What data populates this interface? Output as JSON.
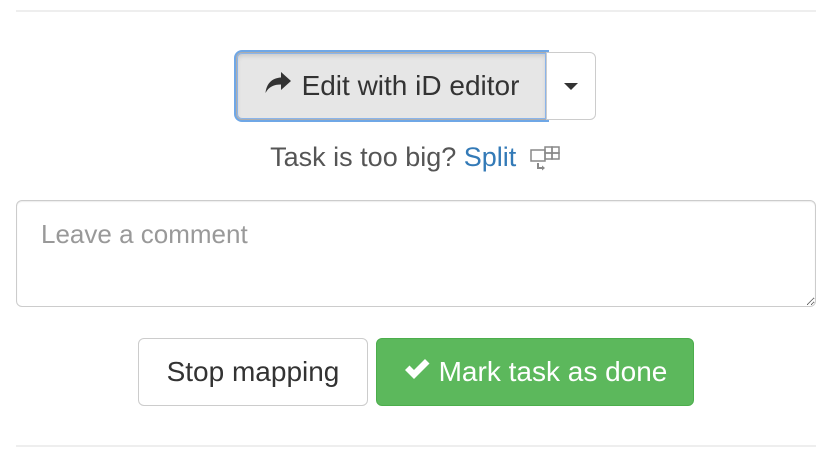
{
  "editor": {
    "edit_label": "Edit with iD editor",
    "edit_icon": "share-arrow-icon",
    "dropdown_icon": "caret-down-icon"
  },
  "split": {
    "prompt": "Task is too big?",
    "link_label": "Split",
    "icon": "split-grid-icon"
  },
  "comment": {
    "placeholder": "Leave a comment",
    "value": ""
  },
  "actions": {
    "stop_label": "Stop mapping",
    "done_label": "Mark task as done",
    "done_icon": "checkmark-icon"
  },
  "colors": {
    "primary_link": "#337ab7",
    "success": "#5cb85c",
    "focus_ring": "#6fa7e6"
  }
}
